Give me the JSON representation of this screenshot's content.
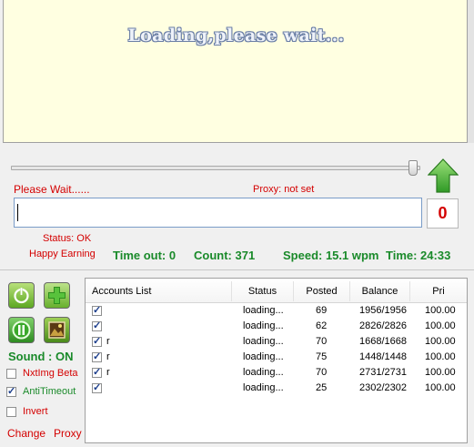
{
  "captcha": {
    "loading_text": "Loading,please wait..."
  },
  "status_bar": {
    "please_wait": "Please Wait......",
    "proxy": "Proxy: not set",
    "status": "Status: OK",
    "happy": "Happy Earning",
    "timeout": "Time out: 0",
    "count": "Count: 371",
    "speed": "Speed: 15.1 wpm",
    "time": "Time: 24:33"
  },
  "input": {
    "value": ""
  },
  "counter": "0",
  "sidebar": {
    "sound": "Sound : ON",
    "options": [
      {
        "label": "NxtImg Beta",
        "checked": false,
        "color": "#d40000"
      },
      {
        "label": "AntiTimeout",
        "checked": true,
        "color": "#1a8a2a"
      },
      {
        "label": "Invert",
        "checked": false,
        "color": "#d40000"
      }
    ],
    "change_label": "Change",
    "proxy_label": "Proxy"
  },
  "accounts": {
    "headers": [
      "Accounts List",
      "Status",
      "Posted",
      "Balance",
      "Pri"
    ],
    "rows": [
      {
        "name": "",
        "status": "loading...",
        "posted": "69",
        "balance": "1956/1956",
        "pri": "100.00"
      },
      {
        "name": "",
        "status": "loading...",
        "posted": "62",
        "balance": "2826/2826",
        "pri": "100.00"
      },
      {
        "name": "r",
        "status": "loading...",
        "posted": "70",
        "balance": "1668/1668",
        "pri": "100.00"
      },
      {
        "name": "r",
        "status": "loading...",
        "posted": "75",
        "balance": "1448/1448",
        "pri": "100.00"
      },
      {
        "name": "r",
        "status": "loading...",
        "posted": "70",
        "balance": "2731/2731",
        "pri": "100.00"
      },
      {
        "name": "",
        "status": "loading...",
        "posted": "25",
        "balance": "2302/2302",
        "pri": "100.00"
      }
    ]
  }
}
